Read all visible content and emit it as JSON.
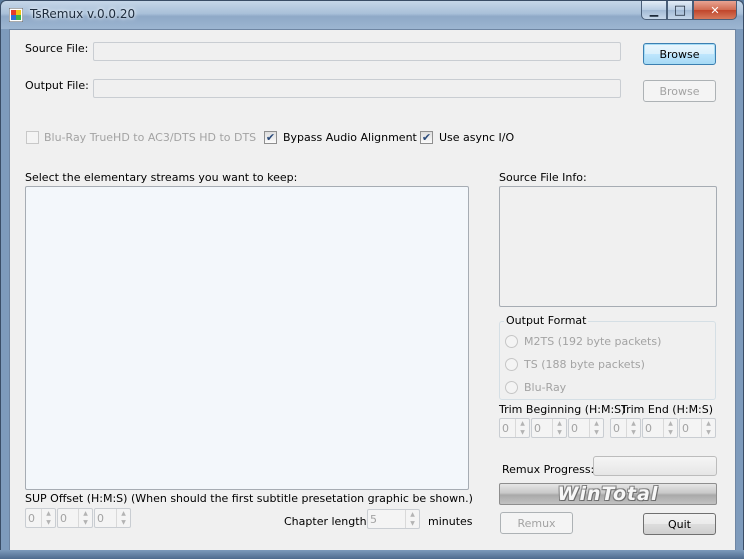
{
  "window": {
    "title": "TsRemux v.0.0.20",
    "icon": "tsremux-app-icon",
    "minimize_glyph": "▁",
    "maximize_glyph": "□",
    "close_glyph": "✕"
  },
  "source": {
    "label": "Source File:",
    "value": "",
    "browse_label": "Browse"
  },
  "output": {
    "label": "Output File:",
    "value": "",
    "browse_label": "Browse"
  },
  "options": {
    "bluray_truehd": {
      "label": "Blu-Ray TrueHD to AC3/DTS HD to DTS",
      "checked": false,
      "enabled": false
    },
    "bypass_audio": {
      "label": "Bypass Audio Alignment",
      "checked": true,
      "enabled": true
    },
    "async_io": {
      "label": "Use async I/O",
      "checked": true,
      "enabled": true
    },
    "check_glyph": "✔"
  },
  "streams": {
    "label": "Select the elementary streams you want to keep:",
    "items": []
  },
  "source_info": {
    "label": "Source File Info:",
    "value": ""
  },
  "output_format": {
    "title": "Output Format",
    "options": [
      {
        "label": "M2TS (192 byte packets)",
        "selected": false
      },
      {
        "label": "TS (188 byte packets)",
        "selected": false
      },
      {
        "label": "Blu-Ray",
        "selected": false
      }
    ]
  },
  "trim": {
    "begin_label": "Trim Beginning (H:M:S)",
    "end_label": "Trim End (H:M:S)",
    "begin": [
      "0",
      "0",
      "0"
    ],
    "end": [
      "0",
      "0",
      "0"
    ]
  },
  "sup_offset": {
    "label": "SUP Offset (H:M:S) (When should the first subtitle presetation graphic be shown.)",
    "values": [
      "0",
      "0",
      "0"
    ]
  },
  "chapter": {
    "label": "Chapter length:",
    "value": "5",
    "unit": "minutes"
  },
  "remux": {
    "progress_label": "Remux Progress:",
    "progress": 0,
    "banner_text": "WinTotal",
    "remux_label": "Remux",
    "quit_label": "Quit"
  },
  "spin_glyphs": {
    "up": "▲",
    "down": "▼"
  },
  "colors": {
    "accent_border": "#3c7fb1",
    "disabled_text": "#a3a3a3",
    "titlebar": "#a9c0d9"
  }
}
